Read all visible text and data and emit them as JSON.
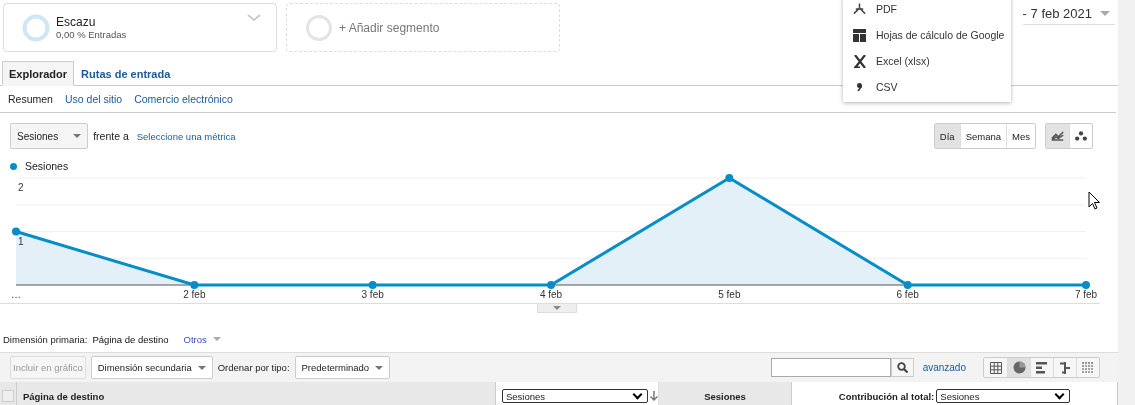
{
  "segments": [
    {
      "name": "Escazu",
      "detail": "0,00 % Entradas",
      "kind": "segment"
    },
    {
      "name": "+ Añadir segmento",
      "kind": "add"
    }
  ],
  "date_range": "- 7 feb 2021",
  "export_menu": [
    {
      "label": "PDF",
      "kind": "pdf"
    },
    {
      "label": "Hojas de cálculo de Google",
      "kind": "sheets"
    },
    {
      "label": "Excel (xlsx)",
      "kind": "excel"
    },
    {
      "label": "CSV",
      "kind": "csv"
    }
  ],
  "tabs": [
    {
      "label": "Explorador",
      "selected": true
    },
    {
      "label": "Rutas de entrada",
      "selected": false
    }
  ],
  "subnav": [
    {
      "label": "Resumen",
      "selected": true
    },
    {
      "label": "Uso del sitio",
      "selected": false
    },
    {
      "label": "Comercio electrónico",
      "selected": false
    }
  ],
  "metric_select": "Sesiones",
  "versus": "frente a",
  "select_metric_link": "Seleccione una métrica",
  "period_buttons": [
    {
      "label": "Día",
      "selected": true
    },
    {
      "label": "Semana",
      "selected": false
    },
    {
      "label": "Mes",
      "selected": false
    }
  ],
  "chart_type_buttons": [
    {
      "kind": "line",
      "selected": true
    },
    {
      "kind": "motion",
      "selected": false
    }
  ],
  "chart": {
    "chart_data": {
      "type": "area",
      "categories": [
        "…",
        "2 feb",
        "3 feb",
        "4 feb",
        "5 feb",
        "6 feb",
        "7 feb"
      ],
      "series": [
        {
          "name": "Sesiones",
          "color": "#058dc7",
          "values": [
            1,
            0,
            0,
            0,
            2,
            0,
            0
          ]
        }
      ],
      "ylim": [
        0,
        2
      ],
      "yticks": [
        {
          "value": 1,
          "label": "1"
        },
        {
          "value": 2,
          "label": "2"
        }
      ]
    }
  },
  "primary_dimension": {
    "label": "Dimensión primaria:",
    "value": "Página de destino",
    "other": "Otros"
  },
  "toolbar": {
    "plot_button": {
      "label": "Incluir en gráfico",
      "disabled": true
    },
    "secondary_dimension": "Dimensión secundaria",
    "sort_label": "Ordenar por tipo:",
    "sort_value": "Predeterminado",
    "advanced": "avanzado",
    "views": [
      {
        "kind": "table",
        "selected": false
      },
      {
        "kind": "pie",
        "selected": true
      },
      {
        "kind": "performance",
        "selected": false
      },
      {
        "kind": "comparison",
        "selected": false
      },
      {
        "kind": "pivot",
        "selected": false
      }
    ]
  },
  "table": {
    "select_all_checked": false,
    "columns": [
      {
        "label": "Página de destino",
        "kind": "text"
      },
      {
        "label": "Sesiones",
        "kind": "select"
      },
      {
        "label": "Sesiones",
        "kind": "text"
      },
      {
        "label": "Contribución al total:",
        "kind": "contribution",
        "value": "Sesiones"
      }
    ]
  }
}
